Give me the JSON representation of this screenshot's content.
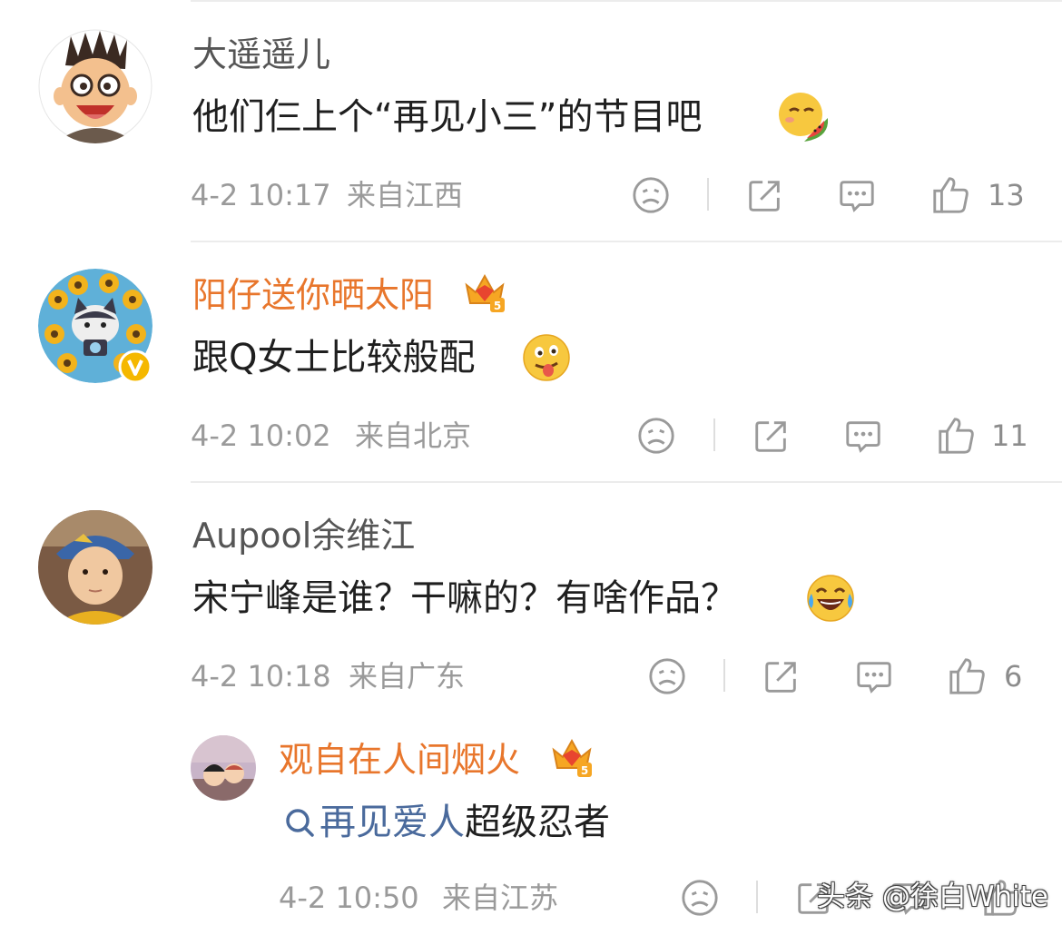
{
  "comments": [
    {
      "username": "大遥遥儿",
      "text": "他们仨上个“再见小三”的节目吧",
      "emoji": "watermelon-face",
      "time": "4-2 10:17",
      "location": "来自江西",
      "likes": "13"
    },
    {
      "username": "阳仔送你晒太阳",
      "text": "跟Q女士比较般配",
      "emoji": "tongue-face",
      "time": "4-2 10:02",
      "location": "来自北京",
      "likes": "11",
      "verified_badge": "V",
      "vip_level": "5"
    },
    {
      "username": "Aupool余维江",
      "text": "宋宁峰是谁？干嘛的？有啥作品？",
      "emoji": "laugh-cry-face",
      "time": "4-2 10:18",
      "location": "来自广东",
      "likes": "6"
    }
  ],
  "reply": {
    "username": "观自在人间烟火",
    "vip_level": "5",
    "link_text": "再见爱人",
    "text": "超级忍者",
    "time": "4-2 10:50",
    "location": "来自江苏"
  },
  "watermark": "头条 @徐白White",
  "icons": [
    "sad-face-icon",
    "share-icon",
    "comment-icon",
    "thumbs-up-icon",
    "search-icon"
  ],
  "colors": {
    "username_orange": "#e8762c",
    "link_blue": "#4a6a9c",
    "meta_gray": "#9a9a9a"
  }
}
